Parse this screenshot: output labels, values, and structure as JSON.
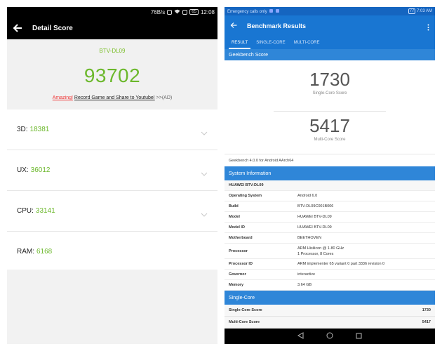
{
  "left": {
    "status": {
      "net_speed": "76B/s",
      "battery": "65",
      "time": "12:08"
    },
    "topbar": {
      "title": "Detail Score"
    },
    "header": {
      "model": "BTV-DL09",
      "total_score": "93702",
      "share_amazing": "Amazing!",
      "share_text": "Record Game and Share to Youtube!",
      "share_ad": ">>(AD)"
    },
    "rows": [
      {
        "label": "3D:",
        "value": "18381"
      },
      {
        "label": "UX:",
        "value": "36012"
      },
      {
        "label": "CPU:",
        "value": "33141"
      },
      {
        "label": "RAM:",
        "value": "6168"
      }
    ]
  },
  "right": {
    "status": {
      "left_text": "Emergency calls only",
      "battery": "77",
      "time": "7:03 AM"
    },
    "appbar": {
      "title": "Benchmark Results"
    },
    "tabs": [
      {
        "label": "RESULT",
        "active": true
      },
      {
        "label": "SINGLE-CORE",
        "active": false
      },
      {
        "label": "MULTI-CORE",
        "active": false
      }
    ],
    "geekbench_header": "Geekbench Score",
    "single_score": "1730",
    "single_caption": "Single-Core Score",
    "multi_score": "5417",
    "multi_caption": "Multi-Core Score",
    "version_text": "Geekbench 4.0.0 for Android AArch64",
    "sysinfo_header": "System Information",
    "device_name": "HUAWEI BTV-DL09",
    "info": [
      {
        "key": "Operating System",
        "value": "Android 6.0"
      },
      {
        "key": "Build",
        "value": "BTV-DL09C001B006"
      },
      {
        "key": "Model",
        "value": "HUAWEI BTV-DL09"
      },
      {
        "key": "Model ID",
        "value": "HUAWEI BTV-DL09"
      },
      {
        "key": "Motherboard",
        "value": "BEETHOVEN"
      },
      {
        "key": "Processor",
        "value": "ARM Hisilicon @ 1.80 GHz",
        "value2": "1 Processor, 8 Cores"
      },
      {
        "key": "Processor ID",
        "value": "ARM implementer 65 variant 0 part 3336 revision 0"
      },
      {
        "key": "Governor",
        "value": "interactive"
      },
      {
        "key": "Memory",
        "value": "3.64 GB"
      }
    ],
    "singlecore_header": "Single-Core",
    "score_rows": [
      {
        "label": "Single-Core Score",
        "value": "1730"
      },
      {
        "label": "Multi-Core Score",
        "value": "5417"
      }
    ]
  }
}
